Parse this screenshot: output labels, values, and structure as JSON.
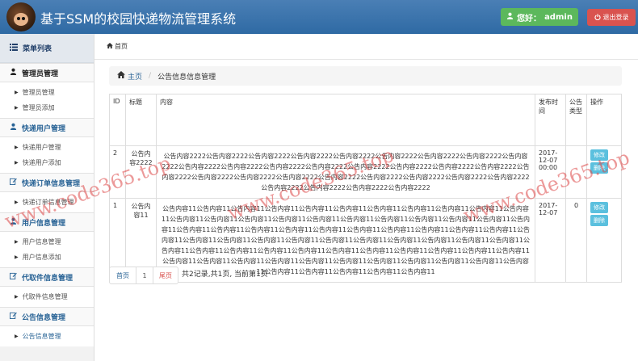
{
  "header": {
    "title": "基于SSM的校园快递物流管理系统",
    "user_label": "您好：",
    "user_name": "admin",
    "logout_label": "退出登录",
    "colors": {
      "bar": "#2f6aa4",
      "user_btn": "#5cb85c",
      "logout_btn": "#d9534f"
    }
  },
  "sidebar": {
    "menu_title": "菜单列表",
    "groups": [
      {
        "title": "管理员管理",
        "items": [
          "管理员管理",
          "管理员添加"
        ]
      },
      {
        "title": "快递用户管理",
        "items": [
          "快递用户管理",
          "快递用户添加"
        ]
      },
      {
        "title": "快递订单信息管理",
        "items": [
          "快递订单信息管理"
        ]
      },
      {
        "title": "用户信息管理",
        "items": [
          "用户信息管理",
          "用户信息添加"
        ]
      },
      {
        "title": "代取件信息管理",
        "items": [
          "代取件信息管理"
        ]
      },
      {
        "title": "公告信息管理",
        "items": [
          "公告信息管理"
        ]
      }
    ]
  },
  "topbar": {
    "label": "首页"
  },
  "breadcrumb": {
    "home": "主页",
    "current": "公告信息信息管理"
  },
  "table": {
    "headers": [
      "ID",
      "标题",
      "内容",
      "发布时间",
      "公告类型",
      "操作"
    ],
    "rows": [
      {
        "id": "2",
        "title": "公告内容2222",
        "content": "公告内容2222公告内容2222公告内容2222公告内容2222公告内容2222公告内容2222公告内容2222公告内容2222公告内容2222公告内容2222公告内容2222公告内容2222公告内容2222公告内容2222公告内容2222公告内容2222公告内容2222公告内容2222公告内容2222公告内容2222公告内容2222公告内容2222公告内容2222公告内容2222公告内容2222公告内容2222公告内容2222公告内容2222公告内容2222公告内容2222",
        "date": "2017-12-07 00:00",
        "type": "",
        "edit": "修改",
        "delete": "删除"
      },
      {
        "id": "1",
        "title": "公告内容11",
        "content": "公告内容11公告内容11公告内容11公告内容11公告内容11公告内容11公告内容11公告内容11公告内容11公告内容11公告内容11公告内容11公告内容11公告内容11公告内容11公告内容11公告内容11公告内容11公告内容11公告内容11公告内容11公告内容11公告内容11公告内容11公告内容11公告内容11公告内容11公告内容11公告内容11公告内容11公告内容11公告内容11公告内容11公告内容11公告内容11公告内容11公告内容11公告内容11公告内容11公告内容11公告内容11公告内容11公告内容11公告内容11公告内容11公告内容11公告内容11公告内容11公告内容11公告内容11公告内容11公告内容11公告内容11公告内容11公告内容11公告内容11公告内容11公告内容11公告内容11公告内容11公告内容11公告内容11公告内容11公告内容11公告内容11公告内容11公告内容11公告内容11公告内容11公告内容11",
        "date": "2017-12-07",
        "type": "0",
        "edit": "修改",
        "delete": "删除"
      }
    ]
  },
  "pager": {
    "first": "首页",
    "page": "1",
    "last": "尾页",
    "info": "共2记录,共1页, 当前第1页"
  },
  "watermark": {
    "text_left": "www.code365.top",
    "text_mid": "www.code365.top",
    "text_right": "www.code365.top"
  }
}
